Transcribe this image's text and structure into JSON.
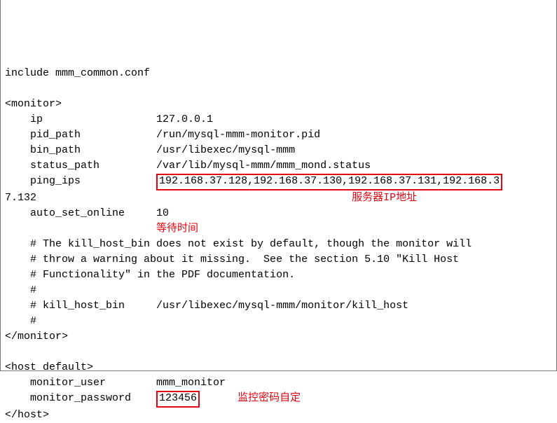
{
  "lines": {
    "include_line": "include mmm_common.conf",
    "monitor_open": "<monitor>",
    "ip_label": "    ip                  ",
    "ip_value": "127.0.0.1",
    "pid_label": "    pid_path            ",
    "pid_value": "/run/mysql-mmm-monitor.pid",
    "bin_label": "    bin_path            ",
    "bin_value": "/usr/libexec/mysql-mmm",
    "status_label": "    status_path         ",
    "status_value": "/var/lib/mysql-mmm/mmm_mond.status",
    "ping_label": "    ping_ips            ",
    "ping_value": "192.168.37.128,192.168.37.130,192.168.37.131,192.168.3",
    "ping_wrap": "7.132",
    "note_server_ip_prefix": "                                                  ",
    "note_server_ip": "服务器IP地址",
    "auto_label": "    auto_set_online     ",
    "auto_value": "10",
    "note_wait_prefix": "                        ",
    "note_wait": "等待时间",
    "comment1": "    # The kill_host_bin does not exist by default, though the monitor will",
    "comment2": "    # throw a warning about it missing.  See the section 5.10 \"Kill Host",
    "comment3": "    # Functionality\" in the PDF documentation.",
    "comment4": "    #",
    "comment5": "    # kill_host_bin     /usr/libexec/mysql-mmm/monitor/kill_host",
    "comment6": "    #",
    "monitor_close": "</monitor>",
    "host_open": "<host default>",
    "muser_label": "    monitor_user        ",
    "muser_value": "mmm_monitor",
    "mpass_label": "    monitor_password    ",
    "mpass_value": "123456",
    "note_password_prefix": "      ",
    "note_password": "监控密码自定",
    "host_close": "</host>"
  }
}
